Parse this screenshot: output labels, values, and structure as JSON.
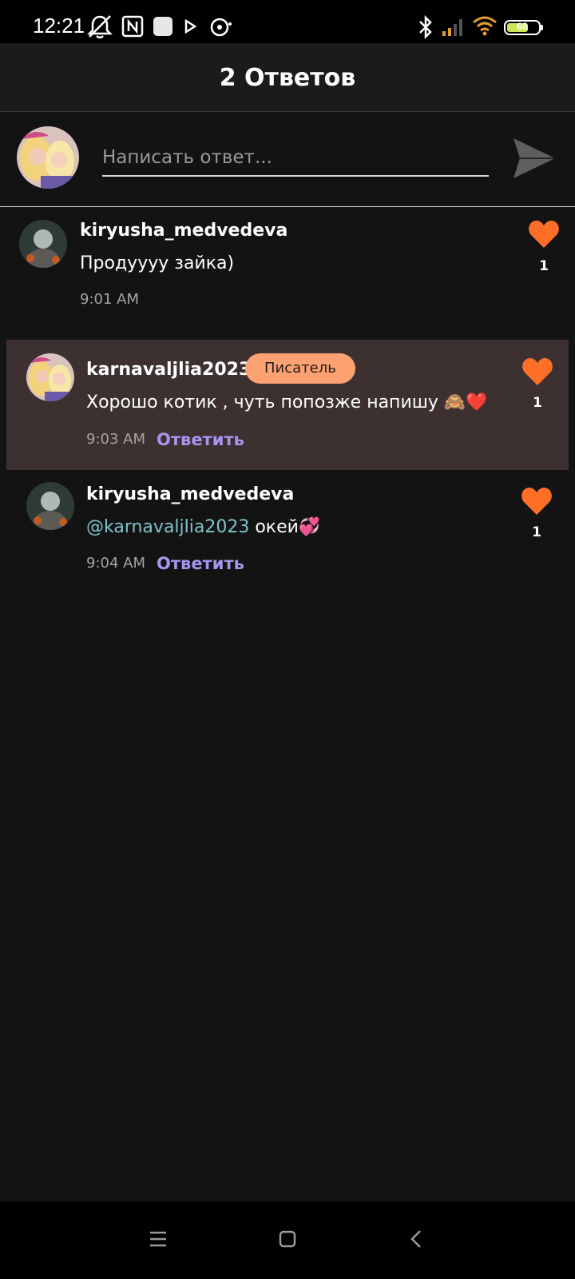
{
  "status_bar": {
    "time": "12:21",
    "battery": "68",
    "battery_color": "#c8e85a",
    "icons": [
      "notifications-muted-icon",
      "nfc-icon",
      "app-notification-icon",
      "play-icon",
      "gallery-notification-icon",
      "bluetooth-icon",
      "cellular-signal-icon",
      "wifi-icon",
      "battery-icon"
    ]
  },
  "header": {
    "title": "2 Ответов"
  },
  "composer": {
    "placeholder": "Написать ответ...",
    "value": ""
  },
  "comments": [
    {
      "username": "kiryusha_medvedeva",
      "text": "Продуууу зайка)",
      "time": "9:01 AM",
      "likes": "1"
    },
    {
      "username": "karnavaljlia2023",
      "badge": "Писатель",
      "text": "Хорошо котик , чуть попозже напишу 🙈❤️",
      "time": "9:03 AM",
      "reply_label": "Ответить",
      "likes": "1",
      "highlighted": true
    },
    {
      "username": "kiryusha_medvedeva",
      "mention": "@karnavaljlia2023",
      "text": " окей💞",
      "time": "9:04 AM",
      "reply_label": "Ответить",
      "likes": "1"
    }
  ],
  "colors": {
    "background": "#141314",
    "accent_like": "#fd6f26",
    "reply_link": "#a796ef",
    "badge": "#fba172",
    "mention": "#7fc3cc",
    "highlight_row": "#3c3030"
  },
  "nav_bar": {
    "icons": [
      "menu-icon",
      "home-icon",
      "back-icon"
    ]
  }
}
